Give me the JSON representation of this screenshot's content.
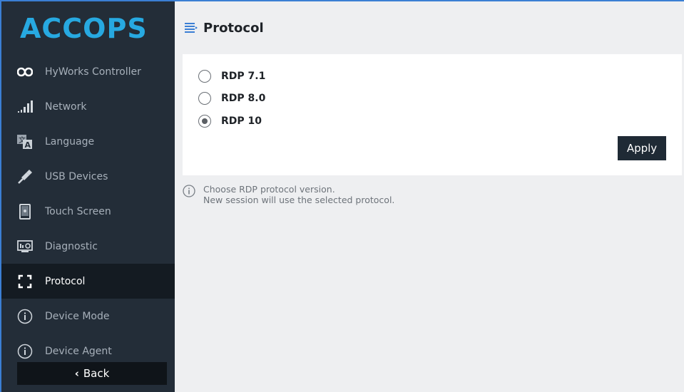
{
  "brand": {
    "logo_text": "ACCOPS",
    "color": "#27a9e1"
  },
  "sidebar": {
    "items": [
      {
        "label": "HyWorks Controller",
        "icon": "infinity-icon",
        "active": false
      },
      {
        "label": "Network",
        "icon": "signal-bars-icon",
        "active": false
      },
      {
        "label": "Language",
        "icon": "language-icon",
        "active": false
      },
      {
        "label": "USB Devices",
        "icon": "usb-plug-icon",
        "active": false
      },
      {
        "label": "Touch Screen",
        "icon": "touch-screen-icon",
        "active": false
      },
      {
        "label": "Diagnostic",
        "icon": "monitor-diagnostic-icon",
        "active": false
      },
      {
        "label": "Protocol",
        "icon": "protocol-icon",
        "active": true
      },
      {
        "label": "Device Mode",
        "icon": "info-circle-icon",
        "active": false
      },
      {
        "label": "Device Agent",
        "icon": "info-circle-icon",
        "active": false
      }
    ],
    "back_label": "Back"
  },
  "page": {
    "title": "Protocol",
    "options": [
      {
        "label": "RDP 7.1",
        "selected": false
      },
      {
        "label": "RDP 8.0",
        "selected": false
      },
      {
        "label": "RDP 10",
        "selected": true
      }
    ],
    "apply_label": "Apply",
    "hint_line1": "Choose RDP protocol version.",
    "hint_line2": "New session will use the selected protocol."
  }
}
